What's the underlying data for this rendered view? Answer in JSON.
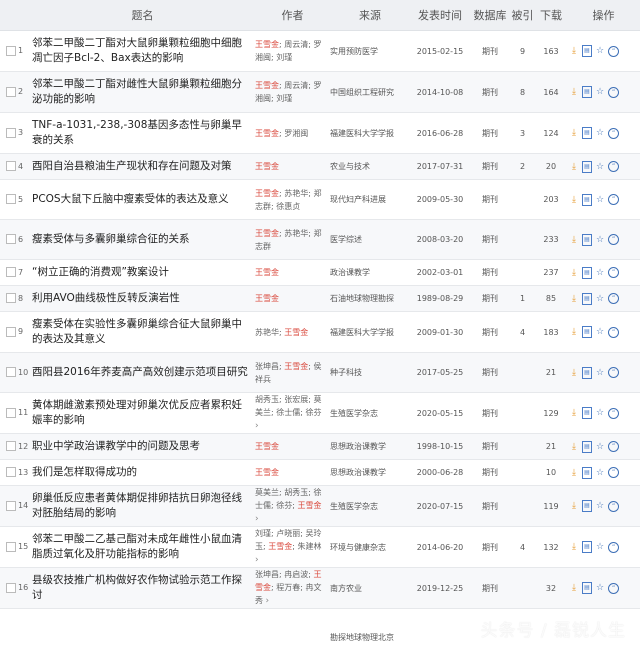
{
  "headers": {
    "title": "题名",
    "author": "作者",
    "source": "来源",
    "date": "发表时间",
    "db": "数据库",
    "cite": "被引",
    "download": "下载",
    "ops": "操作"
  },
  "rows": [
    {
      "n": "1",
      "title": "邻苯二甲酸二丁酯对大鼠卵巢颗粒细胞中细胞凋亡因子Bcl-2、Bax表达的影响",
      "authors": [
        {
          "t": "王雪金",
          "hl": true
        },
        {
          "t": "; 周云清; 罗湘闽; 刘瑾",
          "hl": false
        }
      ],
      "source": "实用预防医学",
      "date": "2015-02-15",
      "db": "期刊",
      "cite": "9",
      "dl": "163"
    },
    {
      "n": "2",
      "title": "邻苯二甲酸二丁酯对雌性大鼠卵巢颗粒细胞分泌功能的影响",
      "authors": [
        {
          "t": "王雪金",
          "hl": true
        },
        {
          "t": "; 周云清; 罗湘闽; 刘瑾",
          "hl": false
        }
      ],
      "source": "中国组织工程研究",
      "date": "2014-10-08",
      "db": "期刊",
      "cite": "8",
      "dl": "164"
    },
    {
      "n": "3",
      "title": "TNF-a-1031,-238,-308基因多态性与卵巢早衰的关系",
      "authors": [
        {
          "t": "王雪金",
          "hl": true
        },
        {
          "t": "; 罗湘闽",
          "hl": false
        }
      ],
      "source": "福建医科大学学报",
      "date": "2016-06-28",
      "db": "期刊",
      "cite": "3",
      "dl": "124"
    },
    {
      "n": "4",
      "title": "酉阳自治县粮油生产现状和存在问题及对策",
      "authors": [
        {
          "t": "王雪金",
          "hl": true
        }
      ],
      "source": "农业与技术",
      "date": "2017-07-31",
      "db": "期刊",
      "cite": "2",
      "dl": "20"
    },
    {
      "n": "5",
      "title": "PCOS大鼠下丘脑中瘦素受体的表达及意义",
      "authors": [
        {
          "t": "王雪金",
          "hl": true
        },
        {
          "t": "; 苏艳华; 郑志群; 徐惠贞",
          "hl": false
        }
      ],
      "source": "现代妇产科进展",
      "date": "2009-05-30",
      "db": "期刊",
      "cite": "",
      "dl": "203"
    },
    {
      "n": "6",
      "title": "瘦素受体与多囊卵巢综合征的关系",
      "authors": [
        {
          "t": "王雪金",
          "hl": true
        },
        {
          "t": "; 苏艳华; 郑志群",
          "hl": false
        }
      ],
      "source": "医学综述",
      "date": "2008-03-20",
      "db": "期刊",
      "cite": "",
      "dl": "233"
    },
    {
      "n": "7",
      "title": "“树立正确的消费观”教案设计",
      "authors": [
        {
          "t": "王雪金",
          "hl": true
        }
      ],
      "source": "政治课教学",
      "date": "2002-03-01",
      "db": "期刊",
      "cite": "",
      "dl": "237"
    },
    {
      "n": "8",
      "title": "利用AVO曲线极性反转反演岩性",
      "authors": [
        {
          "t": "王雪金",
          "hl": true
        }
      ],
      "source": "石油地球物理勘探",
      "date": "1989-08-29",
      "db": "期刊",
      "cite": "1",
      "dl": "85"
    },
    {
      "n": "9",
      "title": "瘦素受体在实验性多囊卵巢综合征大鼠卵巢中的表达及其意义",
      "authors": [
        {
          "t": "苏艳华; ",
          "hl": false
        },
        {
          "t": "王雪金",
          "hl": true
        }
      ],
      "source": "福建医科大学学报",
      "date": "2009-01-30",
      "db": "期刊",
      "cite": "4",
      "dl": "183"
    },
    {
      "n": "10",
      "title": "酉阳县2016年荞麦高产高效创建示范项目研究",
      "authors": [
        {
          "t": "张坤昌; ",
          "hl": false
        },
        {
          "t": "王雪金",
          "hl": true
        },
        {
          "t": "; 侯祥兵",
          "hl": false
        }
      ],
      "source": "种子科技",
      "date": "2017-05-25",
      "db": "期刊",
      "cite": "",
      "dl": "21"
    },
    {
      "n": "11",
      "title": "黄体期雌激素预处理对卵巢次优反应者累积妊娠率的影响",
      "authors": [
        {
          "t": "胡秀玉; 张宏展; 莫美兰; 徐士儒; 徐芬",
          "hl": false
        }
      ],
      "more": true,
      "source": "生殖医学杂志",
      "date": "2020-05-15",
      "db": "期刊",
      "cite": "",
      "dl": "129"
    },
    {
      "n": "12",
      "title": "职业中学政治课教学中的问题及思考",
      "authors": [
        {
          "t": "王雪金",
          "hl": true
        }
      ],
      "source": "思想政治课教学",
      "date": "1998-10-15",
      "db": "期刊",
      "cite": "",
      "dl": "21"
    },
    {
      "n": "13",
      "title": "我们是怎样取得成功的",
      "authors": [
        {
          "t": "王雪金",
          "hl": true
        }
      ],
      "source": "思想政治课教学",
      "date": "2000-06-28",
      "db": "期刊",
      "cite": "",
      "dl": "10"
    },
    {
      "n": "14",
      "title": "卵巢低反应患者黄体期促排卵拮抗日卵泡径线对胚胎结局的影响",
      "authors": [
        {
          "t": "莫美兰; 胡秀玉; 徐士儒; 徐芬; ",
          "hl": false
        },
        {
          "t": "王雪金",
          "hl": true
        }
      ],
      "more": true,
      "source": "生殖医学杂志",
      "date": "2020-07-15",
      "db": "期刊",
      "cite": "",
      "dl": "119"
    },
    {
      "n": "15",
      "title": "邻苯二甲酸二乙基己酯对未成年雌性小鼠血清脂质过氧化及肝功能指标的影响",
      "authors": [
        {
          "t": "刘瑾; 卢晓丽; 吴玲玉; ",
          "hl": false
        },
        {
          "t": "王雪金",
          "hl": true
        },
        {
          "t": "; 朱建林",
          "hl": false
        }
      ],
      "more": true,
      "source": "环境与健康杂志",
      "date": "2014-06-20",
      "db": "期刊",
      "cite": "4",
      "dl": "132"
    },
    {
      "n": "16",
      "title": "县级农技推广机构做好农作物试验示范工作探讨",
      "authors": [
        {
          "t": "张坤昌; 冉启波; ",
          "hl": false
        },
        {
          "t": "王雪金",
          "hl": true
        },
        {
          "t": "; 程万春; 冉文秀",
          "hl": false
        }
      ],
      "more": true,
      "source": "南方农业",
      "date": "2019-12-25",
      "db": "期刊",
      "cite": "",
      "dl": "32"
    }
  ],
  "partial_source": "勘探地球物理北京",
  "icons": [
    "download-icon",
    "read-icon",
    "favorite-icon",
    "cite-icon"
  ],
  "colors": {
    "highlight": "#d9473b",
    "download": "#e69a2e",
    "action": "#3d6fb6"
  },
  "watermark": "头条号 / 磊锐人生"
}
